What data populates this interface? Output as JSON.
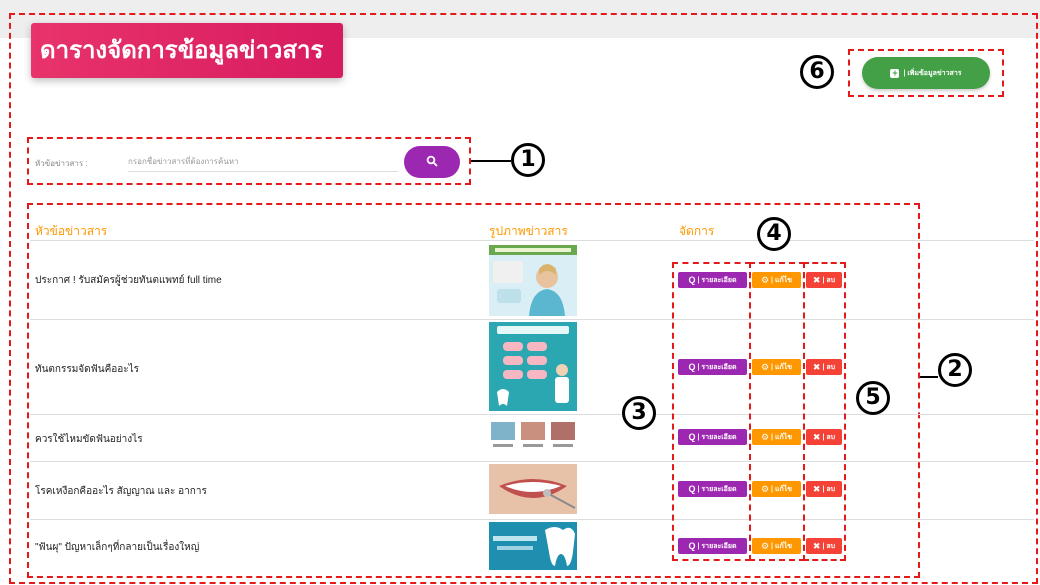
{
  "page": {
    "title": "ดารางจัดการข้อมูลข่าวสาร",
    "add_button": {
      "icon": "plus-square-icon",
      "label": "| เพิ่มข้อมูลข่าวสาร"
    }
  },
  "search": {
    "label": "หัวข้อข่าวสาร :",
    "placeholder": "กรอกชื่อข่าวสารที่ต้องการค้นหา",
    "button_icon": "search-icon",
    "button_glyph": "🔍"
  },
  "table": {
    "columns": [
      "หัวข้อข่าวสาร",
      "รูปภาพข่าวสาร",
      "จัดการ"
    ],
    "actions": {
      "view": "| รายละเอียด",
      "edit": "| แก้ไข",
      "delete": "| ลบ"
    },
    "action_icons": {
      "view": "search-icon",
      "edit": "gears-icon",
      "delete": "close-icon"
    },
    "rows": [
      {
        "title": "ประกาศ ! รับสมัครผู้ช่วยทันตแพทย์ full time",
        "image": "dental-assistant-recruitment-thumbnail"
      },
      {
        "title": "ทันตกรรมจัดฟันคืออะไร",
        "image": "orthodontics-infographic-thumbnail"
      },
      {
        "title": "ควรใช้ไหมขัดฟันอย่างไร",
        "image": "flossing-steps-thumbnail"
      },
      {
        "title": "โรคเหงือกคืออะไร สัญญาณ และ อาการ",
        "image": "smile-dental-mirror-thumbnail"
      },
      {
        "title": "\"ฟันผุ\" ปัญหาเล็กๆที่กลายเป็นเรื่องใหญ่",
        "image": "tooth-decay-banner-thumbnail"
      }
    ]
  },
  "callouts": [
    "1",
    "2",
    "3",
    "4",
    "5",
    "6"
  ],
  "colors": {
    "title_card": "#d81b60",
    "add_button": "#43a047",
    "search_button": "#9c27b0",
    "header_text": "#ff9800",
    "view_button": "#9c27b0",
    "edit_button": "#ff9800",
    "delete_button": "#f44336",
    "annotation": "#e41a1a"
  }
}
